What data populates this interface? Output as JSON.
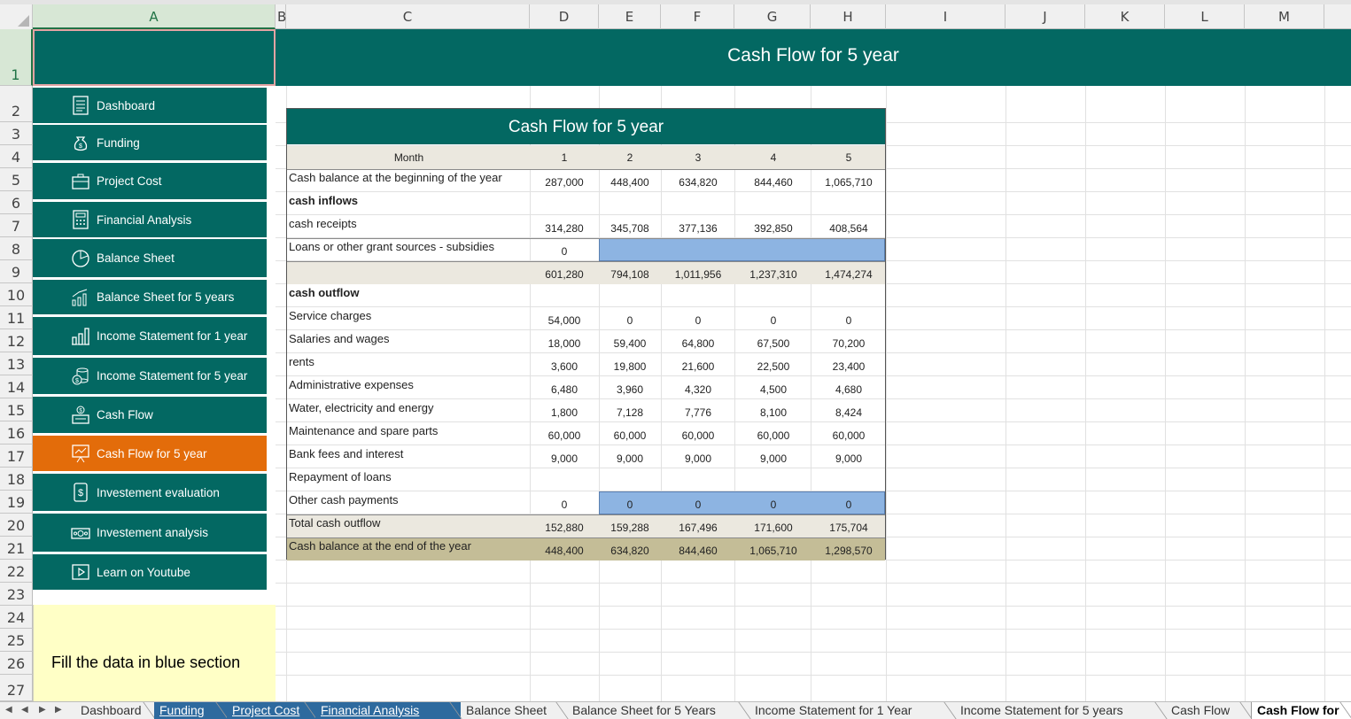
{
  "columns": [
    "A",
    "B",
    "C",
    "D",
    "E",
    "F",
    "G",
    "H",
    "I",
    "J",
    "K",
    "L",
    "M"
  ],
  "rows": [
    "1",
    "2",
    "3",
    "4",
    "5",
    "6",
    "7",
    "8",
    "9",
    "10",
    "11",
    "12",
    "13",
    "14",
    "15",
    "16",
    "17",
    "18",
    "19",
    "20",
    "21",
    "22",
    "23",
    "24",
    "25",
    "26",
    "27"
  ],
  "banner_title": "Cash Flow for 5 year",
  "sidebar": [
    {
      "label": "Dashboard",
      "icon": "dashboard-icon"
    },
    {
      "label": "Funding",
      "icon": "money-bag-icon"
    },
    {
      "label": "Project Cost",
      "icon": "briefcase-icon"
    },
    {
      "label": "Financial Analysis",
      "icon": "calculator-icon"
    },
    {
      "label": "Balance Sheet",
      "icon": "pie-chart-icon"
    },
    {
      "label": "Balance Sheet for 5 years",
      "icon": "growth-chart-icon"
    },
    {
      "label": "Income Statement for 1 year",
      "icon": "bar-chart-icon"
    },
    {
      "label": "Income Statement for 5 year",
      "icon": "coins-stack-icon"
    },
    {
      "label": "Cash Flow",
      "icon": "cash-register-icon"
    },
    {
      "label": "Cash Flow for 5 year",
      "icon": "presentation-chart-icon",
      "active": true
    },
    {
      "label": "Investement evaluation",
      "icon": "dollar-phone-icon"
    },
    {
      "label": "Investement analysis",
      "icon": "banknote-icon"
    },
    {
      "label": "Learn on Youtube",
      "icon": "play-icon"
    }
  ],
  "note": "Fill the data in blue section",
  "table": {
    "title": "Cash Flow for 5 year",
    "header": {
      "label": "Month",
      "values": [
        "1",
        "2",
        "3",
        "4",
        "5"
      ]
    },
    "rows": [
      {
        "label": "Cash balance at the beginning of the year",
        "values": [
          "287,000",
          "448,400",
          "634,820",
          "844,460",
          "1,065,710"
        ]
      },
      {
        "label": "cash inflows",
        "bold": true,
        "values": [
          "",
          "",
          "",
          "",
          ""
        ]
      },
      {
        "label": "cash receipts",
        "values": [
          "314,280",
          "345,708",
          "377,136",
          "392,850",
          "408,564"
        ]
      },
      {
        "label": "Loans or other grant sources - subsidies",
        "values": [
          "0",
          "",
          "",
          "",
          ""
        ]
      },
      {
        "label": "",
        "values": [
          "601,280",
          "794,108",
          "1,011,956",
          "1,237,310",
          "1,474,274"
        ]
      },
      {
        "label": "cash outflow",
        "bold": true,
        "values": [
          "",
          "",
          "",
          "",
          ""
        ]
      },
      {
        "label": "Service charges",
        "values": [
          "54,000",
          "0",
          "0",
          "0",
          "0"
        ]
      },
      {
        "label": "Salaries and wages",
        "values": [
          "18,000",
          "59,400",
          "64,800",
          "67,500",
          "70,200"
        ]
      },
      {
        "label": "rents",
        "values": [
          "3,600",
          "19,800",
          "21,600",
          "22,500",
          "23,400"
        ]
      },
      {
        "label": "Administrative expenses",
        "values": [
          "6,480",
          "3,960",
          "4,320",
          "4,500",
          "4,680"
        ]
      },
      {
        "label": "Water, electricity and energy",
        "values": [
          "1,800",
          "7,128",
          "7,776",
          "8,100",
          "8,424"
        ]
      },
      {
        "label": "Maintenance and spare parts",
        "values": [
          "60,000",
          "60,000",
          "60,000",
          "60,000",
          "60,000"
        ]
      },
      {
        "label": "Bank fees and interest",
        "values": [
          "9,000",
          "9,000",
          "9,000",
          "9,000",
          "9,000"
        ]
      },
      {
        "label": "Repayment of loans",
        "values": [
          "",
          "",
          "",
          "",
          ""
        ]
      },
      {
        "label": "Other cash payments",
        "values": [
          "0",
          "0",
          "0",
          "0",
          "0"
        ]
      },
      {
        "label": "Total cash outflow",
        "values": [
          "152,880",
          "159,288",
          "167,496",
          "171,600",
          "175,704"
        ]
      },
      {
        "label": "Cash balance at the end of the year",
        "values": [
          "448,400",
          "634,820",
          "844,460",
          "1,065,710",
          "1,298,570"
        ]
      }
    ]
  },
  "sheet_tabs": [
    {
      "label": "Dashboard"
    },
    {
      "label": "Funding",
      "style": "blue"
    },
    {
      "label": "Project Cost",
      "style": "blue"
    },
    {
      "label": "Financial Analysis",
      "style": "blue"
    },
    {
      "label": "Balance Sheet"
    },
    {
      "label": "Balance Sheet for 5 Years"
    },
    {
      "label": "Income Statement for 1 Year"
    },
    {
      "label": "Income Statement for 5 years"
    },
    {
      "label": "Cash Flow"
    },
    {
      "label": "Cash Flow for",
      "active": true
    }
  ],
  "colors": {
    "teal": "#036862",
    "orange": "#e36c0a",
    "input_blue": "#8db4e2",
    "note_yellow": "#ffffc6",
    "beige": "#ebe8df",
    "tan": "#c4bd97"
  }
}
